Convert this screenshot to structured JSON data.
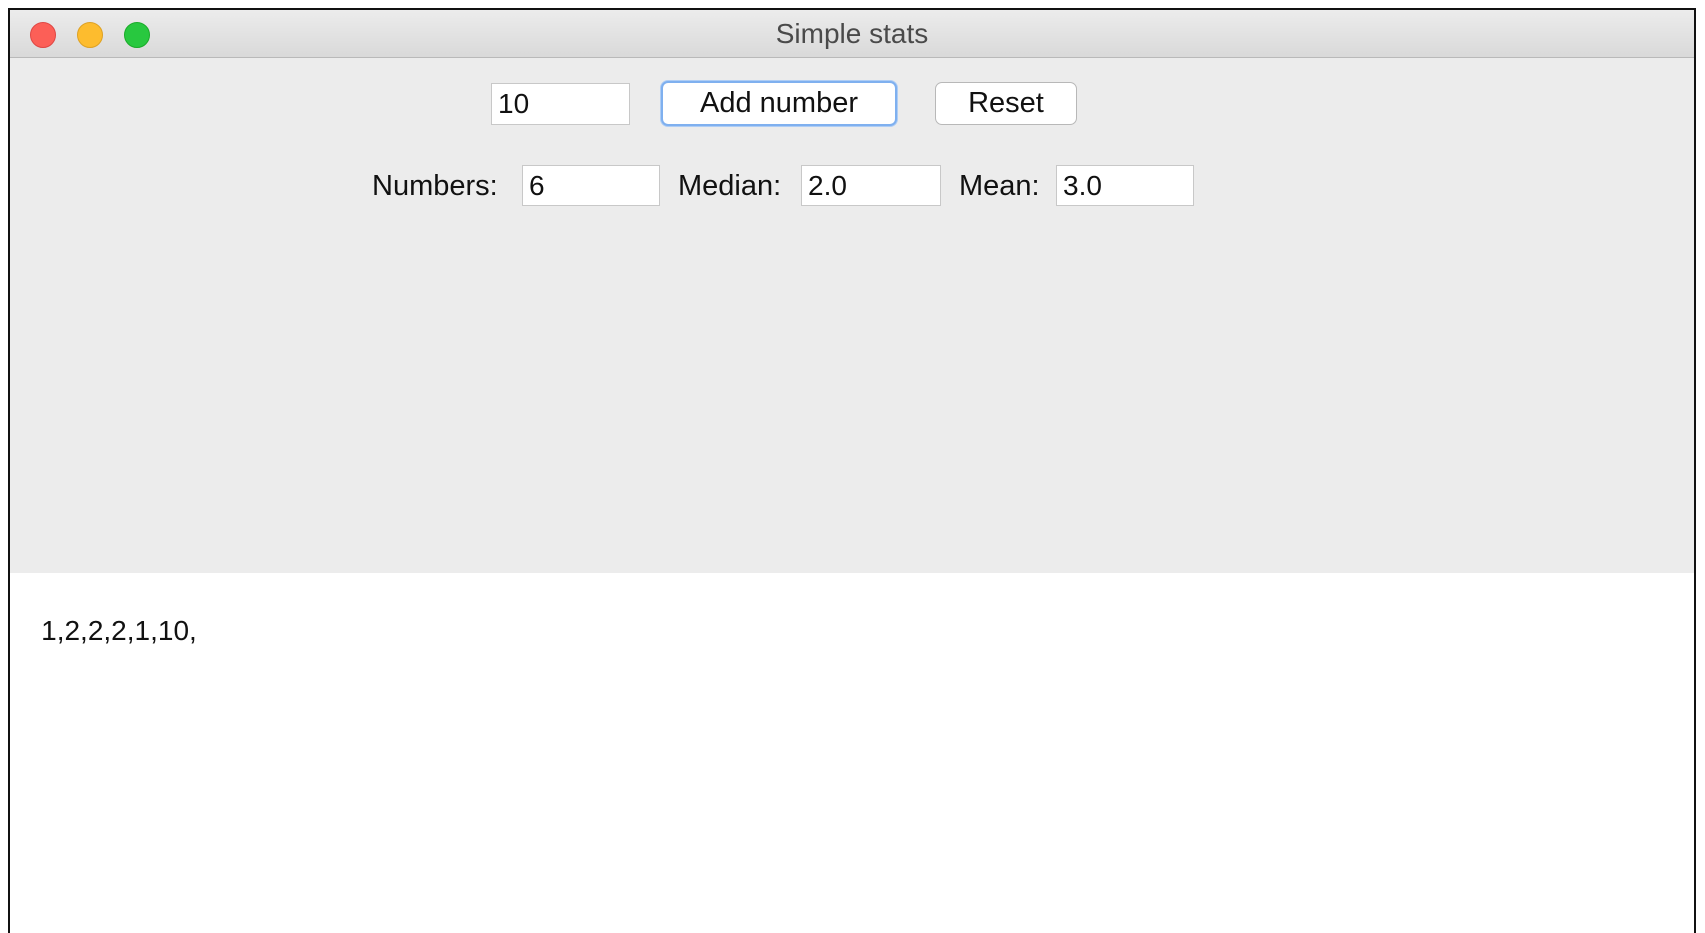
{
  "window": {
    "title": "Simple stats"
  },
  "input": {
    "value": "10"
  },
  "buttons": {
    "add_label": "Add number",
    "reset_label": "Reset"
  },
  "stats": {
    "numbers_label": "Numbers:",
    "numbers_value": "6",
    "median_label": "Median:",
    "median_value": "2.0",
    "mean_label": "Mean:",
    "mean_value": "3.0"
  },
  "output": {
    "text": "1,2,2,2,1,10,"
  },
  "colors": {
    "close": "#fc5f57",
    "minimize": "#fdbc2e",
    "maximize": "#28c83f",
    "panel_background": "#ececec",
    "default_button_focus": "#7fb0ef"
  }
}
